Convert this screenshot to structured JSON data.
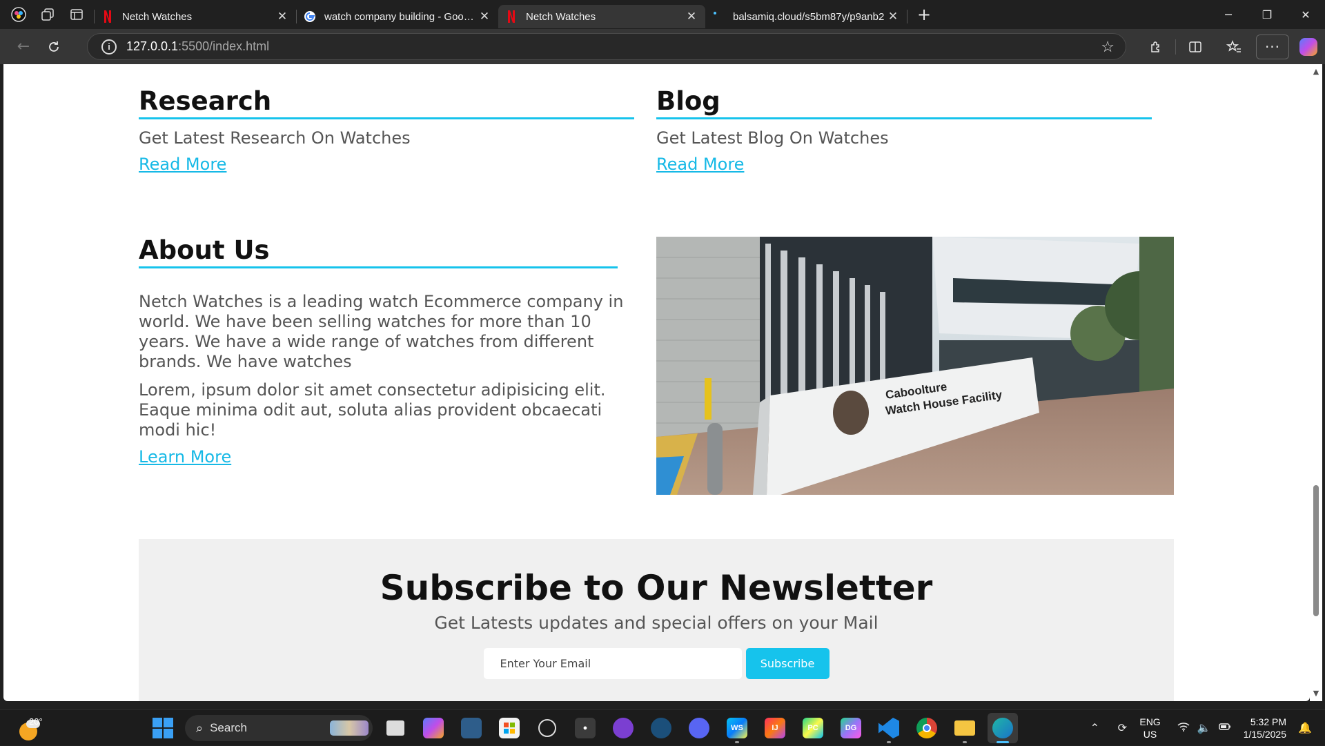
{
  "browser": {
    "tabs": [
      {
        "title": "Netch Watches",
        "favicon": "netflix-icon",
        "active": false
      },
      {
        "title": "watch company building - Google Search",
        "favicon": "google-icon",
        "active": false
      },
      {
        "title": "Netch Watches",
        "favicon": "netflix-icon",
        "active": true
      },
      {
        "title": "balsamiq.cloud/s5bm87y/p9anb2",
        "favicon": "loading-icon",
        "active": false
      }
    ],
    "url_host": "127.0.0.1",
    "url_path": ":5500/index.html"
  },
  "page": {
    "research": {
      "title": "Research",
      "text": "Get Latest Research On Watches",
      "link": "Read More"
    },
    "blog": {
      "title": "Blog",
      "text": "Get Latest Blog On Watches",
      "link": "Read More"
    },
    "about": {
      "title": "About Us",
      "paragraph1": "Netch Watches is a leading watch Ecommerce company in world. We have been selling watches for more than 10 years. We have a wide range of watches from different brands. We have watches",
      "paragraph2": "Lorem, ipsum dolor sit amet consectetur adipisicing elit. Eaque minima odit aut, soluta alias provident obcaecati modi hic!",
      "link": "Learn More",
      "image_sign_line1": "Caboolture",
      "image_sign_line2": "Watch House Facility"
    },
    "newsletter": {
      "title": "Subscribe to Our Newsletter",
      "subtitle": "Get Latests updates and special offers on your Mail",
      "email_placeholder": "Enter Your Email",
      "button": "Subscribe"
    }
  },
  "colors": {
    "accent": "#16c3ec",
    "link": "#16b9e6",
    "newsletter_bg": "#f0f0f0"
  },
  "taskbar": {
    "weather_temp": "20°",
    "search_label": "Search",
    "language_line1": "ENG",
    "language_line2": "US",
    "time": "5:32 PM",
    "date": "1/15/2025"
  }
}
